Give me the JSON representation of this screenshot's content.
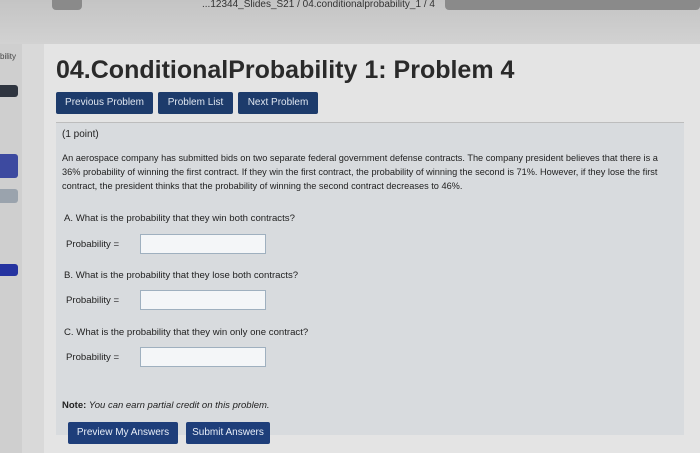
{
  "browser": {
    "path_text": "...12344_Slides_S21 / 04.conditionalprobability_1 / 4"
  },
  "leftrail": {
    "label": "bility"
  },
  "page": {
    "title": "04.ConditionalProbability 1: Problem 4"
  },
  "nav": {
    "previous": "Previous Problem",
    "list": "Problem List",
    "next": "Next Problem"
  },
  "problem": {
    "points": "(1 point)",
    "statement": "An aerospace company has submitted bids on two separate federal government defense contracts. The company president believes that there is a 36% probability of winning the first contract. If they win the first contract, the probability of winning the second is 71%. However, if they lose the first contract, the president thinks that the probability of winning the second contract decreases to 46%.",
    "questions": [
      {
        "text": "A. What is the probability that they win both contracts?",
        "label": "Probability =",
        "value": ""
      },
      {
        "text": "B. What is the probability that they lose both contracts?",
        "label": "Probability =",
        "value": ""
      },
      {
        "text": "C. What is the probability that they win only one contract?",
        "label": "Probability =",
        "value": ""
      }
    ]
  },
  "note": {
    "label": "Note:",
    "text": "You can earn partial credit on this problem."
  },
  "actions": {
    "preview": "Preview My Answers",
    "submit": "Submit Answers"
  },
  "colors": {
    "nav_button": "#1d3b6b",
    "rail_purple": "#3d4aa0",
    "rail_blue": "#2533a0"
  }
}
